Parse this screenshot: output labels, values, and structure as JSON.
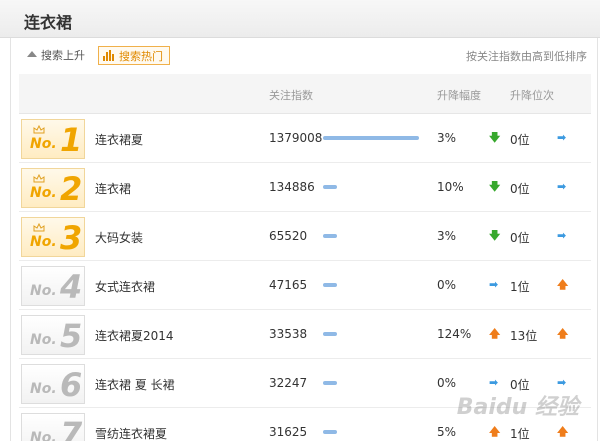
{
  "header": {
    "title": "连衣裙"
  },
  "toolbar": {
    "tab_rise_label": "搜索上升",
    "tab_hot_label": "搜索热门",
    "sort_hint": "按关注指数由高到低排序"
  },
  "table": {
    "col_index": "关注指数",
    "col_change": "升降幅度",
    "col_position": "升降位次"
  },
  "colors": {
    "accent": "#f0a500",
    "bar": "#8fb9e6",
    "down": "#37a82d",
    "flat": "#3c9ae0",
    "up": "#ef7d1b"
  },
  "rows": [
    {
      "no": "No.",
      "rank": "1",
      "word": "连衣裙夏",
      "index": "1379008",
      "index_value": 1379008,
      "change": "3%",
      "change_icon": "down-arrow-icon",
      "position": "0位",
      "position_icon": "right-arrow-icon"
    },
    {
      "no": "No.",
      "rank": "2",
      "word": "连衣裙",
      "index": "134886",
      "index_value": 134886,
      "change": "10%",
      "change_icon": "down-arrow-icon",
      "position": "0位",
      "position_icon": "right-arrow-icon"
    },
    {
      "no": "No.",
      "rank": "3",
      "word": "大码女装",
      "index": "65520",
      "index_value": 65520,
      "change": "3%",
      "change_icon": "down-arrow-icon",
      "position": "0位",
      "position_icon": "right-arrow-icon"
    },
    {
      "no": "No.",
      "rank": "4",
      "word": "女式连衣裙",
      "index": "47165",
      "index_value": 47165,
      "change": "0%",
      "change_icon": "right-arrow-icon",
      "position": "1位",
      "position_icon": "up-arrow-icon"
    },
    {
      "no": "No.",
      "rank": "5",
      "word": "连衣裙夏2014",
      "index": "33538",
      "index_value": 33538,
      "change": "124%",
      "change_icon": "up-arrow-icon",
      "position": "13位",
      "position_icon": "up-arrow-icon"
    },
    {
      "no": "No.",
      "rank": "6",
      "word": "连衣裙 夏 长裙",
      "index": "32247",
      "index_value": 32247,
      "change": "0%",
      "change_icon": "right-arrow-icon",
      "position": "0位",
      "position_icon": "right-arrow-icon"
    },
    {
      "no": "No.",
      "rank": "7",
      "word": "雪纺连衣裙夏",
      "index": "31625",
      "index_value": 31625,
      "change": "5%",
      "change_icon": "up-arrow-icon",
      "position": "1位",
      "position_icon": "up-arrow-icon"
    }
  ],
  "watermark": "Baidu 经验"
}
